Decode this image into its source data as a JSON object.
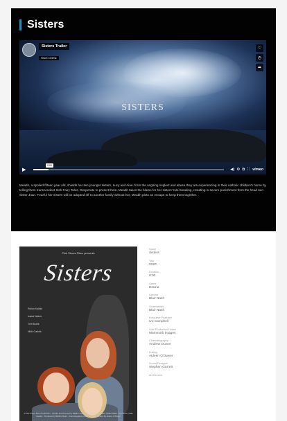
{
  "accent": "#1e90c9",
  "page": {
    "title": "Sisters"
  },
  "video": {
    "title": "Sisters Trailer",
    "channel": "Vision Cinema",
    "caption": "SISTERS",
    "timestamp": "0:00",
    "progress_fraction": 0.08,
    "brand": "vimeo",
    "side_icons": [
      "heart-icon",
      "clock-icon",
      "share-icon"
    ],
    "control_icons": [
      "volume-icon",
      "settings-icon",
      "pip-icon",
      "fullscreen-icon"
    ]
  },
  "synopsis": "Meabh, a spoiled fifteen year old, shields her two younger sisters, Lucy and Aine, from the ongoing neglect and abuse they are experiencing in their catholic children's home by telling them transcendent Irish Fairy Tales. Desperate to protect them, Meabh takes the blame for her sisters' rule breaking, resulting in severe punishment from the head nun Sister Joan. Fearful her sisters will be adopted off to another family without her, Meabh plots an escape to keep them together.",
  "poster": {
    "top_text": "Pink Shoes Films presents",
    "title": "Sisters",
    "cast": [
      "Róisín Kaliski",
      "Isabel Walsh",
      "Tom Burke",
      "Nikki Gaddis"
    ],
    "credits": "A Pink Shoes Films Production · Written and Directed by Bláithín Nash · Starring Róisín Kaliski, Isabel Walsh, Tom Burke, Nikki Gaddis · Produced by Bláithín Nash · Cinematography Andrew Dunne · Edited by Aideen O'Dwyer"
  },
  "details": [
    {
      "label": "Name",
      "value": "Sisters"
    },
    {
      "label": "Year",
      "value": "2020"
    },
    {
      "label": "Duration",
      "value": "8:00"
    },
    {
      "label": "Genre",
      "value": "Drama"
    },
    {
      "label": "Director",
      "value": "Blair Nash"
    },
    {
      "label": "Screenwriter",
      "value": "Blair Nash"
    },
    {
      "label": "Executive Producer",
      "value": "Ivo Campbell"
    },
    {
      "label": "Sole Production House",
      "value": "Mammoth Images"
    },
    {
      "label": "Cinematography",
      "value": "Andrew Dunne"
    },
    {
      "label": "Editing",
      "value": "Aideen O'Dwyer"
    },
    {
      "label": "Sound Designer",
      "value": "Stephen Garrett"
    },
    {
      "label": "Art Director",
      "value": ""
    }
  ]
}
